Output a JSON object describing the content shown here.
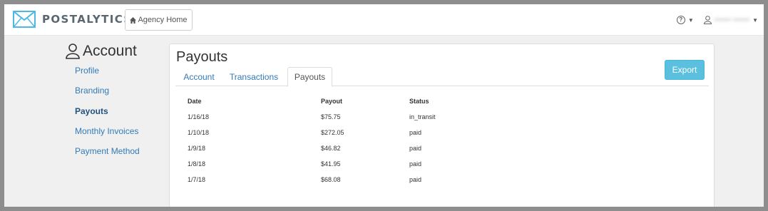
{
  "brand": {
    "name": "POSTALYTICS",
    "logo_color": "#4db8e6"
  },
  "header": {
    "agency_button_label": "Agency Home",
    "help_icon": "help-icon",
    "user_icon": "user-icon",
    "user_name": "•••••• ••••••"
  },
  "sidebar": {
    "title": "Account",
    "items": [
      {
        "label": "Profile",
        "active": false
      },
      {
        "label": "Branding",
        "active": false
      },
      {
        "label": "Payouts",
        "active": true
      },
      {
        "label": "Monthly Invoices",
        "active": false
      },
      {
        "label": "Payment Method",
        "active": false
      }
    ]
  },
  "main": {
    "title": "Payouts",
    "export_label": "Export",
    "accent": "#5bc0de",
    "tabs": [
      {
        "label": "Account",
        "active": false
      },
      {
        "label": "Transactions",
        "active": false
      },
      {
        "label": "Payouts",
        "active": true
      }
    ],
    "table": {
      "columns": [
        "Date",
        "Payout",
        "Status"
      ],
      "rows": [
        [
          "1/16/18",
          "$75.75",
          "in_transit"
        ],
        [
          "1/10/18",
          "$272.05",
          "paid"
        ],
        [
          "1/9/18",
          "$46.82",
          "paid"
        ],
        [
          "1/8/18",
          "$41.95",
          "paid"
        ],
        [
          "1/7/18",
          "$68.08",
          "paid"
        ]
      ]
    }
  }
}
